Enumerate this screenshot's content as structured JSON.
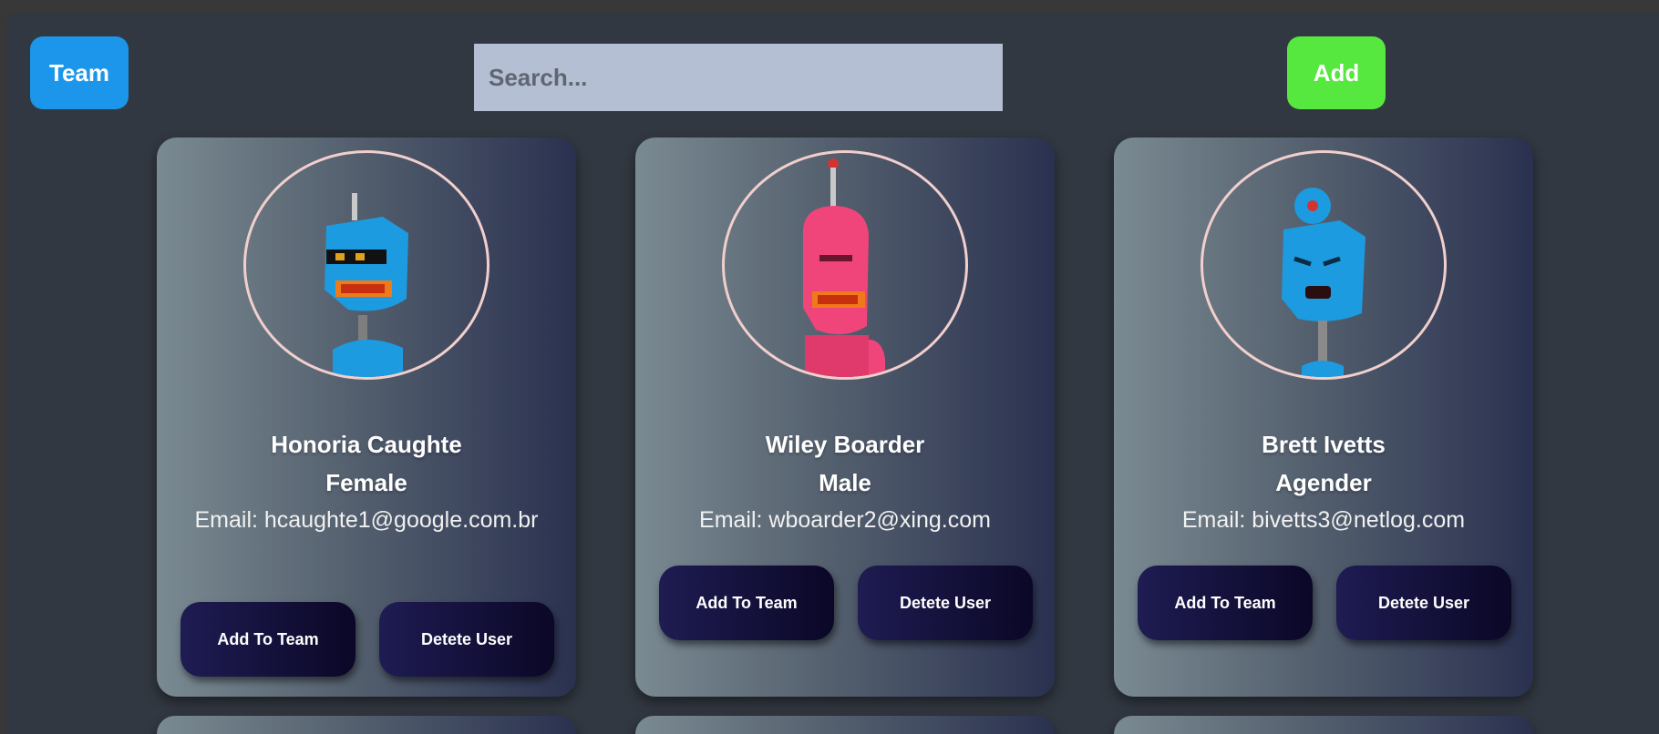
{
  "header": {
    "team_label": "Team",
    "search_placeholder": "Search...",
    "add_label": "Add"
  },
  "colors": {
    "team_button": "#1c96ea",
    "add_button": "#56e83f",
    "search_bg": "#b4bfd3",
    "card_button": "#0b0727",
    "avatar_ring": "#f1cfcc"
  },
  "users": [
    {
      "name": "Honoria Caughte",
      "gender": "Female",
      "email_text": "Email: hcaughte1@google.com.br",
      "avatar_icon": "blue-robot-avatar-icon",
      "add_label": "Add To Team",
      "delete_label": "Detete User"
    },
    {
      "name": "Wiley Boarder",
      "gender": "Male",
      "email_text": "Email: wboarder2@xing.com",
      "avatar_icon": "pink-robot-avatar-icon",
      "add_label": "Add To Team",
      "delete_label": "Detete User"
    },
    {
      "name": "Brett Ivetts",
      "gender": "Agender",
      "email_text": "Email: bivetts3@netlog.com",
      "avatar_icon": "blue-robot-avatar-icon",
      "add_label": "Add To Team",
      "delete_label": "Detete User"
    }
  ]
}
